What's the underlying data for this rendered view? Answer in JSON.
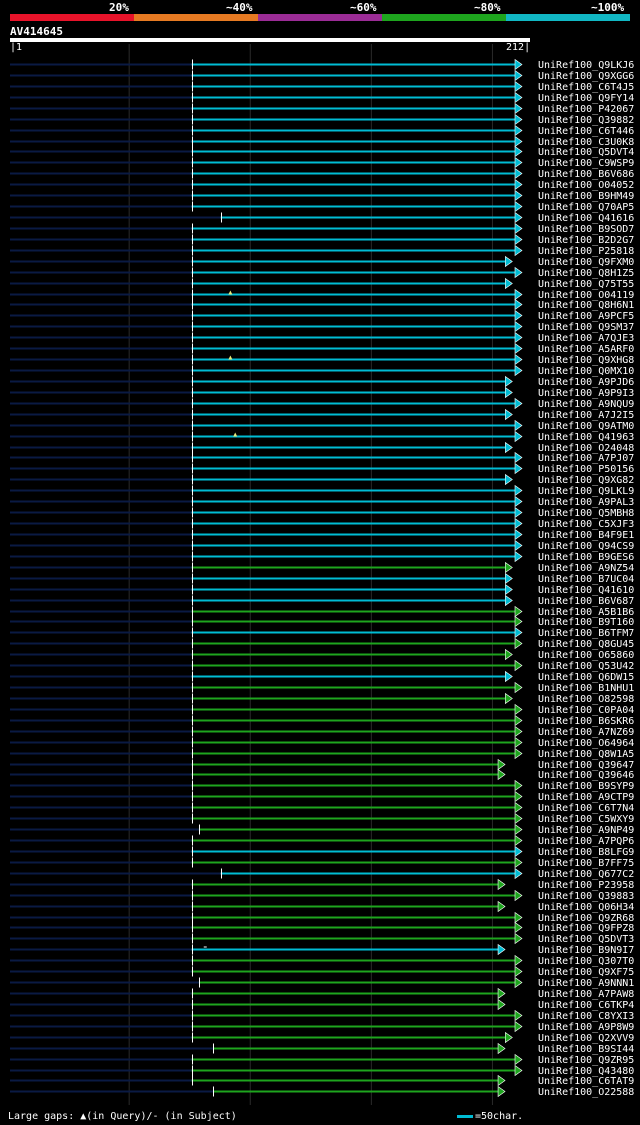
{
  "query": {
    "id": "AV414645",
    "start": "1",
    "end": "212",
    "length": 212
  },
  "identity_legend": [
    {
      "label": "20%",
      "color": "#e8132a"
    },
    {
      "label": "~40%",
      "color": "#e67a22"
    },
    {
      "label": "~60%",
      "color": "#9b2c96"
    },
    {
      "label": "~80%",
      "color": "#1ea51e"
    },
    {
      "label": "~100%",
      "color": "#11b7c4"
    }
  ],
  "colors": {
    "cyan": "#00bcd4",
    "green": "#1ea51e",
    "unaligned": "#0a1a44",
    "gridline": "#2a2a2a",
    "gap_marker": "#e8e87a"
  },
  "hits": [
    {
      "name": "UniRef100_Q9LKJ6",
      "color": "cyan",
      "start": 76,
      "end": 212
    },
    {
      "name": "UniRef100_Q9XGG6",
      "color": "cyan",
      "start": 76,
      "end": 212
    },
    {
      "name": "UniRef100_C6T4J5",
      "color": "cyan",
      "start": 76,
      "end": 212
    },
    {
      "name": "UniRef100_Q9FY14",
      "color": "cyan",
      "start": 76,
      "end": 212
    },
    {
      "name": "UniRef100_P42067",
      "color": "cyan",
      "start": 76,
      "end": 212
    },
    {
      "name": "UniRef100_Q39882",
      "color": "cyan",
      "start": 76,
      "end": 212
    },
    {
      "name": "UniRef100_C6T446",
      "color": "cyan",
      "start": 76,
      "end": 212
    },
    {
      "name": "UniRef100_C3U0K8",
      "color": "cyan",
      "start": 76,
      "end": 212
    },
    {
      "name": "UniRef100_Q5DVT4",
      "color": "cyan",
      "start": 76,
      "end": 212
    },
    {
      "name": "UniRef100_C9WSP9",
      "color": "cyan",
      "start": 76,
      "end": 212
    },
    {
      "name": "UniRef100_B6V686",
      "color": "cyan",
      "start": 76,
      "end": 212
    },
    {
      "name": "UniRef100_O04052",
      "color": "cyan",
      "start": 76,
      "end": 212
    },
    {
      "name": "UniRef100_B9HM49",
      "color": "cyan",
      "start": 76,
      "end": 212
    },
    {
      "name": "UniRef100_Q70AP5",
      "color": "cyan",
      "start": 76,
      "end": 212
    },
    {
      "name": "UniRef100_Q41616",
      "color": "cyan",
      "start": 88,
      "end": 212
    },
    {
      "name": "UniRef100_B9SOD7",
      "color": "cyan",
      "start": 76,
      "end": 212
    },
    {
      "name": "UniRef100_B2D2G7",
      "color": "cyan",
      "start": 76,
      "end": 212
    },
    {
      "name": "UniRef100_P25818",
      "color": "cyan",
      "start": 76,
      "end": 212
    },
    {
      "name": "UniRef100_Q9FXM0",
      "color": "cyan",
      "start": 76,
      "end": 208
    },
    {
      "name": "UniRef100_Q8H1Z5",
      "color": "cyan",
      "start": 76,
      "end": 212
    },
    {
      "name": "UniRef100_Q75T55",
      "color": "cyan",
      "start": 76,
      "end": 208
    },
    {
      "name": "UniRef100_O04119",
      "color": "cyan",
      "start": 76,
      "end": 212,
      "gap": 92
    },
    {
      "name": "UniRef100_Q8H6N1",
      "color": "cyan",
      "start": 76,
      "end": 212
    },
    {
      "name": "UniRef100_A9PCF5",
      "color": "cyan",
      "start": 76,
      "end": 212
    },
    {
      "name": "UniRef100_Q9SM37",
      "color": "cyan",
      "start": 76,
      "end": 212
    },
    {
      "name": "UniRef100_A7QJE3",
      "color": "cyan",
      "start": 76,
      "end": 212
    },
    {
      "name": "UniRef100_A5ARF0",
      "color": "cyan",
      "start": 76,
      "end": 212
    },
    {
      "name": "UniRef100_Q9XHG8",
      "color": "cyan",
      "start": 76,
      "end": 212,
      "gap": 92
    },
    {
      "name": "UniRef100_Q0MX10",
      "color": "cyan",
      "start": 76,
      "end": 212
    },
    {
      "name": "UniRef100_A9PJD6",
      "color": "cyan",
      "start": 76,
      "end": 208
    },
    {
      "name": "UniRef100_A9P9I3",
      "color": "cyan",
      "start": 76,
      "end": 208
    },
    {
      "name": "UniRef100_A9NQU9",
      "color": "cyan",
      "start": 76,
      "end": 212
    },
    {
      "name": "UniRef100_A7J2I5",
      "color": "cyan",
      "start": 76,
      "end": 208
    },
    {
      "name": "UniRef100_Q9ATM0",
      "color": "cyan",
      "start": 76,
      "end": 212
    },
    {
      "name": "UniRef100_Q41963",
      "color": "cyan",
      "start": 76,
      "end": 212,
      "gap": 94
    },
    {
      "name": "UniRef100_O24048",
      "color": "cyan",
      "start": 76,
      "end": 208
    },
    {
      "name": "UniRef100_A7PJ07",
      "color": "cyan",
      "start": 76,
      "end": 212
    },
    {
      "name": "UniRef100_P50156",
      "color": "cyan",
      "start": 76,
      "end": 212
    },
    {
      "name": "UniRef100_Q9XG82",
      "color": "cyan",
      "start": 76,
      "end": 208
    },
    {
      "name": "UniRef100_Q9LKL9",
      "color": "cyan",
      "start": 76,
      "end": 212
    },
    {
      "name": "UniRef100_A9PAL3",
      "color": "cyan",
      "start": 76,
      "end": 212
    },
    {
      "name": "UniRef100_Q5MBH8",
      "color": "cyan",
      "start": 76,
      "end": 212
    },
    {
      "name": "UniRef100_C5XJF3",
      "color": "cyan",
      "start": 76,
      "end": 212
    },
    {
      "name": "UniRef100_B4F9E1",
      "color": "cyan",
      "start": 76,
      "end": 212
    },
    {
      "name": "UniRef100_Q94CS9",
      "color": "cyan",
      "start": 76,
      "end": 212
    },
    {
      "name": "UniRef100_B9GES6",
      "color": "cyan",
      "start": 76,
      "end": 212
    },
    {
      "name": "UniRef100_A9NZ54",
      "color": "green",
      "start": 76,
      "end": 208
    },
    {
      "name": "UniRef100_B7UC04",
      "color": "cyan",
      "start": 76,
      "end": 208
    },
    {
      "name": "UniRef100_Q41610",
      "color": "cyan",
      "start": 76,
      "end": 208
    },
    {
      "name": "UniRef100_B6V687",
      "color": "cyan",
      "start": 76,
      "end": 208
    },
    {
      "name": "UniRef100_A5B1B6",
      "color": "green",
      "start": 76,
      "end": 212
    },
    {
      "name": "UniRef100_B9T160",
      "color": "green",
      "start": 76,
      "end": 212
    },
    {
      "name": "UniRef100_B6TFM7",
      "color": "cyan",
      "start": 76,
      "end": 212
    },
    {
      "name": "UniRef100_Q8GU45",
      "color": "green",
      "start": 76,
      "end": 212
    },
    {
      "name": "UniRef100_O65860",
      "color": "green",
      "start": 76,
      "end": 208
    },
    {
      "name": "UniRef100_Q53U42",
      "color": "green",
      "start": 76,
      "end": 212
    },
    {
      "name": "UniRef100_Q6DW15",
      "color": "cyan",
      "start": 76,
      "end": 208
    },
    {
      "name": "UniRef100_B1NHU1",
      "color": "green",
      "start": 76,
      "end": 212
    },
    {
      "name": "UniRef100_O82598",
      "color": "green",
      "start": 76,
      "end": 208
    },
    {
      "name": "UniRef100_C0PA04",
      "color": "green",
      "start": 76,
      "end": 212
    },
    {
      "name": "UniRef100_B6SKR6",
      "color": "green",
      "start": 76,
      "end": 212
    },
    {
      "name": "UniRef100_A7NZ69",
      "color": "green",
      "start": 76,
      "end": 212
    },
    {
      "name": "UniRef100_O64964",
      "color": "green",
      "start": 76,
      "end": 212
    },
    {
      "name": "UniRef100_Q8W1A5",
      "color": "green",
      "start": 76,
      "end": 212
    },
    {
      "name": "UniRef100_Q39647",
      "color": "green",
      "start": 76,
      "end": 205
    },
    {
      "name": "UniRef100_Q39646",
      "color": "green",
      "start": 76,
      "end": 205
    },
    {
      "name": "UniRef100_B9SYP9",
      "color": "green",
      "start": 76,
      "end": 212
    },
    {
      "name": "UniRef100_A9CTP9",
      "color": "green",
      "start": 76,
      "end": 212
    },
    {
      "name": "UniRef100_C6T7N4",
      "color": "green",
      "start": 76,
      "end": 212
    },
    {
      "name": "UniRef100_C5WXY9",
      "color": "green",
      "start": 76,
      "end": 212
    },
    {
      "name": "UniRef100_A9NP49",
      "color": "green",
      "start": 79,
      "end": 212
    },
    {
      "name": "UniRef100_A7PQP6",
      "color": "green",
      "start": 76,
      "end": 212
    },
    {
      "name": "UniRef100_B8LFG9",
      "color": "cyan",
      "start": 76,
      "end": 212
    },
    {
      "name": "UniRef100_B7FF75",
      "color": "green",
      "start": 76,
      "end": 212
    },
    {
      "name": "UniRef100_Q677C2",
      "color": "cyan",
      "start": 88,
      "end": 212
    },
    {
      "name": "UniRef100_P23958",
      "color": "green",
      "start": 76,
      "end": 205
    },
    {
      "name": "UniRef100_Q39883",
      "color": "green",
      "start": 76,
      "end": 212
    },
    {
      "name": "UniRef100_Q06H34",
      "color": "green",
      "start": 76,
      "end": 205
    },
    {
      "name": "UniRef100_Q9ZR68",
      "color": "green",
      "start": 76,
      "end": 212
    },
    {
      "name": "UniRef100_Q9FPZ8",
      "color": "green",
      "start": 76,
      "end": 212
    },
    {
      "name": "UniRef100_Q5DVT3",
      "color": "green",
      "start": 76,
      "end": 212
    },
    {
      "name": "UniRef100_B9N9I7",
      "color": "cyan",
      "start": 76,
      "end": 205,
      "gap_line": 81
    },
    {
      "name": "UniRef100_Q307T0",
      "color": "green",
      "start": 76,
      "end": 212
    },
    {
      "name": "UniRef100_Q9XF75",
      "color": "green",
      "start": 76,
      "end": 212
    },
    {
      "name": "UniRef100_A9NNN1",
      "color": "green",
      "start": 79,
      "end": 212
    },
    {
      "name": "UniRef100_A7PAW8",
      "color": "green",
      "start": 76,
      "end": 205
    },
    {
      "name": "UniRef100_C6TKP4",
      "color": "green",
      "start": 76,
      "end": 205
    },
    {
      "name": "UniRef100_C8YXI3",
      "color": "green",
      "start": 76,
      "end": 212
    },
    {
      "name": "UniRef100_A9P8W9",
      "color": "green",
      "start": 76,
      "end": 212
    },
    {
      "name": "UniRef100_Q2XVV9",
      "color": "green",
      "start": 76,
      "end": 208
    },
    {
      "name": "UniRef100_B9SI44",
      "color": "green",
      "start": 85,
      "end": 205
    },
    {
      "name": "UniRef100_Q9ZR95",
      "color": "green",
      "start": 76,
      "end": 212
    },
    {
      "name": "UniRef100_Q43480",
      "color": "green",
      "start": 76,
      "end": 212
    },
    {
      "name": "UniRef100_C6TAT9",
      "color": "green",
      "start": 76,
      "end": 205
    },
    {
      "name": "UniRef100_O22588",
      "color": "green",
      "start": 85,
      "end": 205
    }
  ],
  "footer": {
    "gaps_text": "Large gaps: ▲(in Query)/- (in Subject)",
    "scale_text": "=50char."
  }
}
